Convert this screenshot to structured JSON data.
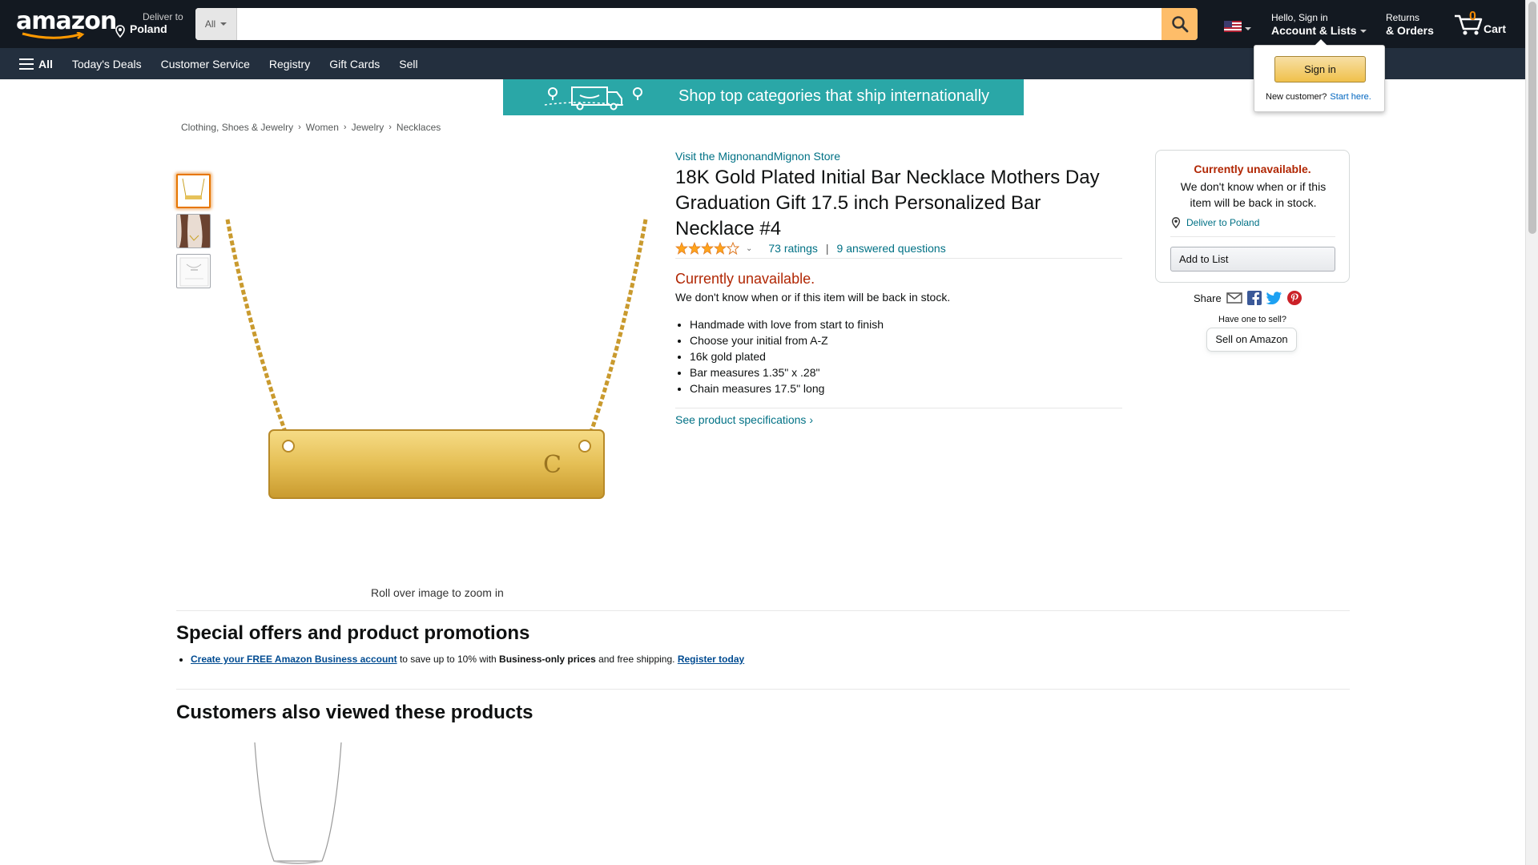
{
  "header": {
    "logo_text": "amazon",
    "deliver_to_label": "Deliver to",
    "deliver_to_location": "Poland",
    "search_category": "All",
    "search_placeholder": "",
    "account_greeting": "Hello, Sign in",
    "account_label": "Account & Lists",
    "returns_label": "Returns",
    "orders_label": "& Orders",
    "cart_count": "0",
    "cart_label": "Cart"
  },
  "subnav": {
    "all_label": "All",
    "items": [
      "Today's Deals",
      "Customer Service",
      "Registry",
      "Gift Cards",
      "Sell"
    ]
  },
  "signin_flyout": {
    "button_label": "Sign in",
    "new_customer": "New customer?",
    "start_here": "Start here."
  },
  "banner": {
    "text": "Shop top categories that ship internationally"
  },
  "breadcrumb": [
    "Clothing, Shoes & Jewelry",
    "Women",
    "Jewelry",
    "Necklaces"
  ],
  "gallery": {
    "zoom_hint": "Roll over image to zoom in",
    "main_initial": "C"
  },
  "product": {
    "store_link": "Visit the MignonandMignon Store",
    "title": "18K Gold Plated Initial Bar Necklace Mothers Day Graduation Gift 17.5 inch Personalized Bar Necklace #4",
    "rating": 4.0,
    "ratings_count": "73 ratings",
    "answered_questions": "9 answered questions",
    "availability": "Currently unavailable.",
    "availability_note": "We don't know when or if this item will be back in stock.",
    "bullets": [
      "Handmade with love from start to finish",
      "Choose your initial from A-Z",
      "16k gold plated",
      "Bar measures 1.35\" x .28\"",
      "Chain measures 17.5\" long"
    ],
    "specs_link": "See product specifications"
  },
  "buybox": {
    "status": "Currently unavailable.",
    "note": "We don't know when or if this item will be back in stock.",
    "deliver": "Deliver to Poland",
    "add_to_list": "Add to List",
    "share_label": "Share",
    "have_one": "Have one to sell?",
    "sell_button": "Sell on Amazon"
  },
  "offers": {
    "heading": "Special offers and product promotions",
    "link1": "Create your FREE Amazon Business account",
    "text1": " to save up to 10% with ",
    "bold": "Business-only prices",
    "text2": " and free shipping. ",
    "link2": "Register today"
  },
  "also_viewed": {
    "heading": "Customers also viewed these products"
  },
  "colors": {
    "nav_dark": "#131921",
    "nav_sub": "#232f3e",
    "search_button": "#febd69",
    "link": "#007185",
    "price_red": "#B12704",
    "star": "#FFA41C",
    "banner": "#2aa7a7"
  }
}
